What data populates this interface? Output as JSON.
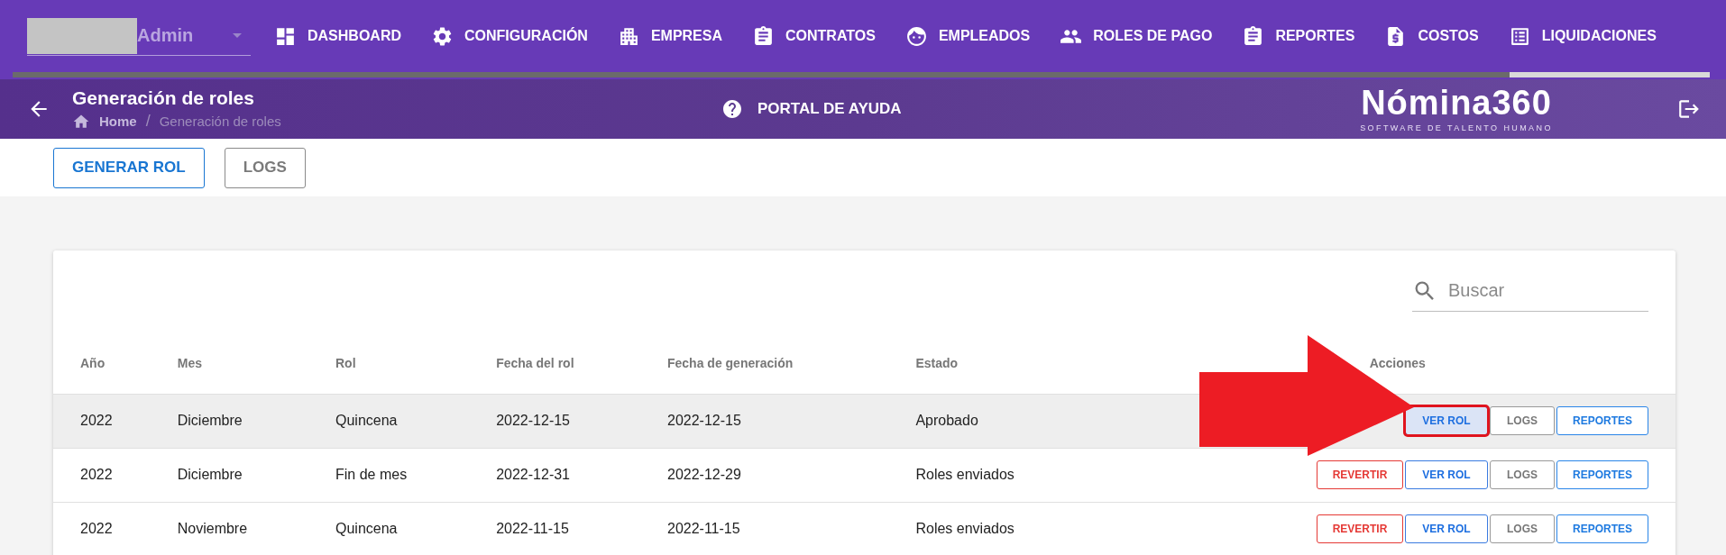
{
  "nav": {
    "user": "Admin",
    "items": [
      {
        "label": "DASHBOARD"
      },
      {
        "label": "CONFIGURACIÓN"
      },
      {
        "label": "EMPRESA"
      },
      {
        "label": "CONTRATOS"
      },
      {
        "label": "EMPLEADOS"
      },
      {
        "label": "ROLES DE PAGO"
      },
      {
        "label": "REPORTES"
      },
      {
        "label": "COSTOS"
      },
      {
        "label": "LIQUIDACIONES"
      }
    ]
  },
  "header": {
    "title": "Generación de roles",
    "breadcrumb": [
      "Home",
      "Generación de roles"
    ],
    "separator": "/",
    "help": "PORTAL DE AYUDA",
    "logo": {
      "name": "Nómina360",
      "tagline": "SOFTWARE DE TALENTO HUMANO"
    }
  },
  "toolbar": [
    {
      "label": "GENERAR ROL",
      "kind": "primary"
    },
    {
      "label": "LOGS",
      "kind": "secondary"
    }
  ],
  "search": {
    "placeholder": "Buscar"
  },
  "table": {
    "columns": [
      "Año",
      "Mes",
      "Rol",
      "Fecha del rol",
      "Fecha de generación",
      "Estado",
      "Acciones"
    ],
    "rows": [
      {
        "selected": true,
        "cells": [
          "2022",
          "Diciembre",
          "Quincena",
          "2022-12-15",
          "2022-12-15",
          "Aprobado"
        ],
        "actions": [
          {
            "kind": "view",
            "label": "VER ROL",
            "highlighted": true
          },
          {
            "kind": "logs",
            "label": "LOGS",
            "highlighted": false
          },
          {
            "kind": "reports",
            "label": "REPORTES",
            "highlighted": false
          }
        ]
      },
      {
        "selected": false,
        "cells": [
          "2022",
          "Diciembre",
          "Fin de mes",
          "2022-12-31",
          "2022-12-29",
          "Roles enviados"
        ],
        "actions": [
          {
            "kind": "revert",
            "label": "REVERTIR",
            "highlighted": false
          },
          {
            "kind": "view",
            "label": "VER ROL",
            "highlighted": false
          },
          {
            "kind": "logs",
            "label": "LOGS",
            "highlighted": false
          },
          {
            "kind": "reports",
            "label": "REPORTES",
            "highlighted": false
          }
        ]
      },
      {
        "selected": false,
        "cells": [
          "2022",
          "Noviembre",
          "Quincena",
          "2022-11-15",
          "2022-11-15",
          "Roles enviados"
        ],
        "actions": [
          {
            "kind": "revert",
            "label": "REVERTIR",
            "highlighted": false
          },
          {
            "kind": "view",
            "label": "VER ROL",
            "highlighted": false
          },
          {
            "kind": "logs",
            "label": "LOGS",
            "highlighted": false
          },
          {
            "kind": "reports",
            "label": "REPORTES",
            "highlighted": false
          }
        ]
      }
    ]
  },
  "annotation": {
    "kind": "arrow"
  }
}
